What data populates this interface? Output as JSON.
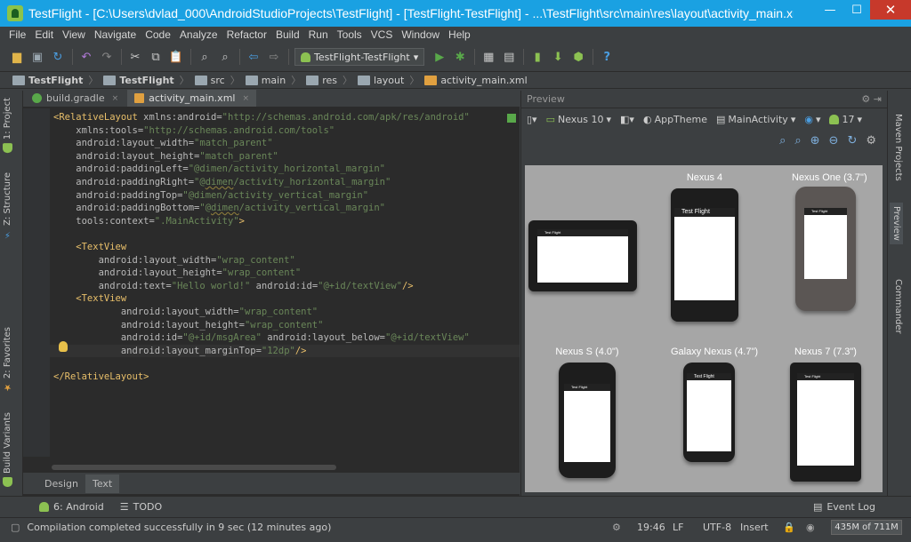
{
  "window": {
    "title": "TestFlight - [C:\\Users\\dvlad_000\\AndroidStudioProjects\\TestFlight] - [TestFlight-TestFlight] - ...\\TestFlight\\src\\main\\res\\layout\\activity_main.xml",
    "minimize": "—",
    "maximize": "☐",
    "close": "✕"
  },
  "menu": [
    "File",
    "Edit",
    "View",
    "Navigate",
    "Code",
    "Analyze",
    "Refactor",
    "Build",
    "Run",
    "Tools",
    "VCS",
    "Window",
    "Help"
  ],
  "toolbar": {
    "run_config": "TestFlight-TestFlight",
    "help": "?"
  },
  "breadcrumbs": [
    "TestFlight",
    "TestFlight",
    "src",
    "main",
    "res",
    "layout",
    "activity_main.xml"
  ],
  "tabs": [
    {
      "label": "build.gradle",
      "close": "×"
    },
    {
      "label": "activity_main.xml",
      "close": "×"
    }
  ],
  "left_tools": [
    "1: Project",
    "Z: Structure",
    "2: Favorites",
    "Build Variants"
  ],
  "right_tools": [
    "Maven Projects",
    "Preview",
    "Commander"
  ],
  "code": [
    [
      [
        "t",
        "<RelativeLayout "
      ],
      [
        "a",
        "xmlns:android="
      ],
      [
        "v",
        "\"http://schemas.android.com/apk/res/android\""
      ]
    ],
    [
      [
        "a",
        "    xmlns:tools="
      ],
      [
        "v",
        "\"http://schemas.android.com/tools\""
      ]
    ],
    [
      [
        "a",
        "    android:layout_width="
      ],
      [
        "v",
        "\"match_parent\""
      ]
    ],
    [
      [
        "a",
        "    android:layout_height="
      ],
      [
        "v",
        "\"match_parent\""
      ]
    ],
    [
      [
        "a",
        "    android:paddingLeft="
      ],
      [
        "v",
        "\"@dimen/activity_horizontal_margin\""
      ]
    ],
    [
      [
        "a",
        "    android:paddingRight="
      ],
      [
        "v",
        "\"@"
      ],
      [
        "u",
        "dimen"
      ],
      [
        "v",
        "/activity_horizontal_margin\""
      ]
    ],
    [
      [
        "a",
        "    android:paddingTop="
      ],
      [
        "v",
        "\"@dimen/activity_vertical_margin\""
      ]
    ],
    [
      [
        "a",
        "    android:paddingBottom="
      ],
      [
        "v",
        "\"@"
      ],
      [
        "u",
        "dimen"
      ],
      [
        "v",
        "/activity_vertical_margin\""
      ]
    ],
    [
      [
        "a",
        "    tools:context="
      ],
      [
        "v",
        "\".MainActivity\""
      ],
      [
        "t",
        ">"
      ]
    ],
    [
      [
        "a",
        ""
      ]
    ],
    [
      [
        "t",
        "    <TextView"
      ]
    ],
    [
      [
        "a",
        "        android:layout_width="
      ],
      [
        "v",
        "\"wrap_content\""
      ]
    ],
    [
      [
        "a",
        "        android:layout_height="
      ],
      [
        "v",
        "\"wrap_content\""
      ]
    ],
    [
      [
        "a",
        "        android:text="
      ],
      [
        "v",
        "\"Hello world!\""
      ],
      [
        "a",
        " android:id="
      ],
      [
        "v",
        "\"@+id/textView\""
      ],
      [
        "t",
        "/>"
      ]
    ],
    [
      [
        "t",
        "    <TextView"
      ]
    ],
    [
      [
        "a",
        "            android:layout_width="
      ],
      [
        "v",
        "\"wrap_content\""
      ]
    ],
    [
      [
        "a",
        "            android:layout_height="
      ],
      [
        "v",
        "\"wrap_content\""
      ]
    ],
    [
      [
        "a",
        "            android:id="
      ],
      [
        "v",
        "\"@+id/msgArea\""
      ],
      [
        "a",
        " android:layout_below="
      ],
      [
        "v",
        "\"@+id/textView\""
      ]
    ],
    [
      [
        "a",
        "            android:layout_marginTop="
      ],
      [
        "v",
        "\"12dp\""
      ],
      [
        "t",
        "/>"
      ]
    ],
    [
      [
        "a",
        ""
      ]
    ],
    [
      [
        "t",
        "</RelativeLayout>"
      ]
    ]
  ],
  "bottom_tabs": [
    "Design",
    "Text"
  ],
  "preview": {
    "title": "Preview",
    "device": "Nexus 10",
    "theme": "AppTheme",
    "activity": "MainActivity",
    "api": "17"
  },
  "devices": [
    {
      "label": "",
      "app": "Test Flight"
    },
    {
      "label": "Nexus 4",
      "app": "Test Flight"
    },
    {
      "label": "Nexus One (3.7\")",
      "app": "Test Flight"
    },
    {
      "label": "Nexus S (4.0\")",
      "app": "Test Flight"
    },
    {
      "label": "Galaxy Nexus (4.7\")",
      "app": "Test Flight"
    },
    {
      "label": "Nexus 7 (7.3\")",
      "app": "Test Flight"
    }
  ],
  "status_tools": {
    "android": "6: Android",
    "todo": "TODO",
    "event_log": "Event Log"
  },
  "status": {
    "message": "Compilation completed successfully in 9 sec (12 minutes ago)",
    "position": "19:46",
    "line_sep": "LF",
    "encoding": "UTF-8",
    "mode": "Insert",
    "memory": "435M of 711M"
  }
}
